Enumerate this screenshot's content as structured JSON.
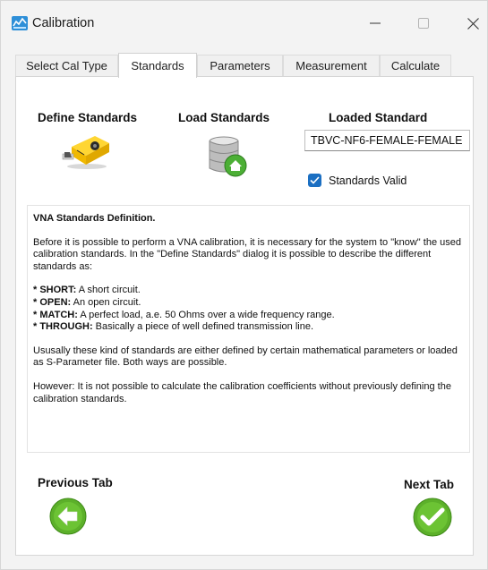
{
  "window": {
    "title": "Calibration",
    "app_icon": "calibration-app-icon",
    "controls": [
      "minimize-icon",
      "maximize-icon",
      "close-icon"
    ]
  },
  "tabs": [
    {
      "label": "Select Cal Type",
      "active": false
    },
    {
      "label": "Standards",
      "active": true
    },
    {
      "label": "Parameters",
      "active": false
    },
    {
      "label": "Measurement",
      "active": false
    },
    {
      "label": "Calculate",
      "active": false
    }
  ],
  "standards": {
    "define_label": "Define Standards",
    "define_icon": "tape-measure-icon",
    "load_label": "Load Standards",
    "load_icon": "database-home-icon",
    "loaded_label": "Loaded Standard",
    "loaded_value": "TBVC-NF6-FEMALE-FEMALE",
    "valid_label": "Standards Valid",
    "valid_checked": true
  },
  "description": {
    "heading": "VNA Standards Definition.",
    "intro": "Before it is possible to perform a VNA calibration, it is necessary for the system to \"know\" the used calibration standards. In the \"Define Standards\" dialog it is possible to describe the different standards as:",
    "items": [
      {
        "key": "* SHORT:",
        "text": " A short circuit."
      },
      {
        "key": "* OPEN:",
        "text": " An open circuit."
      },
      {
        "key": "* MATCH:",
        "text": " A perfect load, a.e. 50 Ohms over a wide frequency range."
      },
      {
        "key": "* THROUGH:",
        "text": " Basically a piece of well defined transmission line."
      }
    ],
    "para2": "Ususally these kind of standards are either defined by certain mathematical parameters or loaded as S-Parameter file. Both ways are possible.",
    "para3": "However: It is not possible to calculate the calibration coefficients without previously defining the calibration standards."
  },
  "navigation": {
    "previous_label": "Previous Tab",
    "previous_icon": "arrow-left-circle-icon",
    "next_label": "Next Tab",
    "next_icon": "checkmark-circle-icon"
  },
  "colors": {
    "accent": "#1b6fc2",
    "nav_green": "#5cb02a",
    "tape_yellow": "#f5c400"
  }
}
